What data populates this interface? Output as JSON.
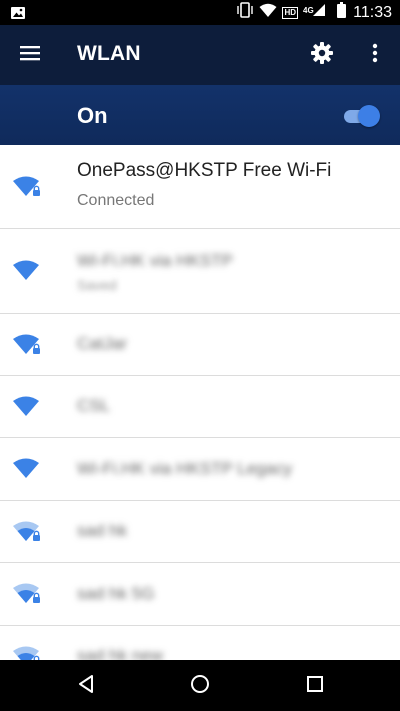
{
  "status_bar": {
    "time": "11:33",
    "network_type": "4G",
    "hd_label": "HD",
    "icons": [
      "image-notification-icon",
      "vibrate-icon",
      "wifi-signal-icon",
      "hd-badge",
      "cell-signal-icon",
      "battery-icon"
    ]
  },
  "app_bar": {
    "title": "WLAN",
    "icons": [
      "menu-icon",
      "gear-icon",
      "more-vert-icon"
    ]
  },
  "wifi_toggle": {
    "label": "On",
    "state": true,
    "accent": "#3d7fe6"
  },
  "networks": [
    {
      "name": "OnePass@HKSTP Free Wi-Fi",
      "status": "Connected",
      "secured": true,
      "signal": "full",
      "obscured": false
    },
    {
      "name": "Wi-Fi.HK via HKSTP",
      "status": "Saved",
      "secured": false,
      "signal": "full",
      "obscured": true
    },
    {
      "name": "CatJar",
      "status": "",
      "secured": true,
      "signal": "full",
      "obscured": true
    },
    {
      "name": "CSL",
      "status": "",
      "secured": false,
      "signal": "full",
      "obscured": true
    },
    {
      "name": "Wi-Fi.HK via HKSTP Legacy",
      "status": "",
      "secured": false,
      "signal": "full",
      "obscured": true
    },
    {
      "name": "sad hk",
      "status": "",
      "secured": true,
      "signal": "partial",
      "obscured": true
    },
    {
      "name": "sad hk 5G",
      "status": "",
      "secured": true,
      "signal": "partial",
      "obscured": true
    },
    {
      "name": "sad hk new",
      "status": "",
      "secured": true,
      "signal": "partial",
      "obscured": true
    }
  ],
  "nav_bar": {
    "icons": [
      "back-icon",
      "home-icon",
      "recents-icon"
    ]
  },
  "colors": {
    "app_bar": "#0d1d3b",
    "toggle_bar": "#13326a",
    "wifi_icon": "#3b82e6",
    "wifi_icon_weak": "#a8c8f2"
  }
}
